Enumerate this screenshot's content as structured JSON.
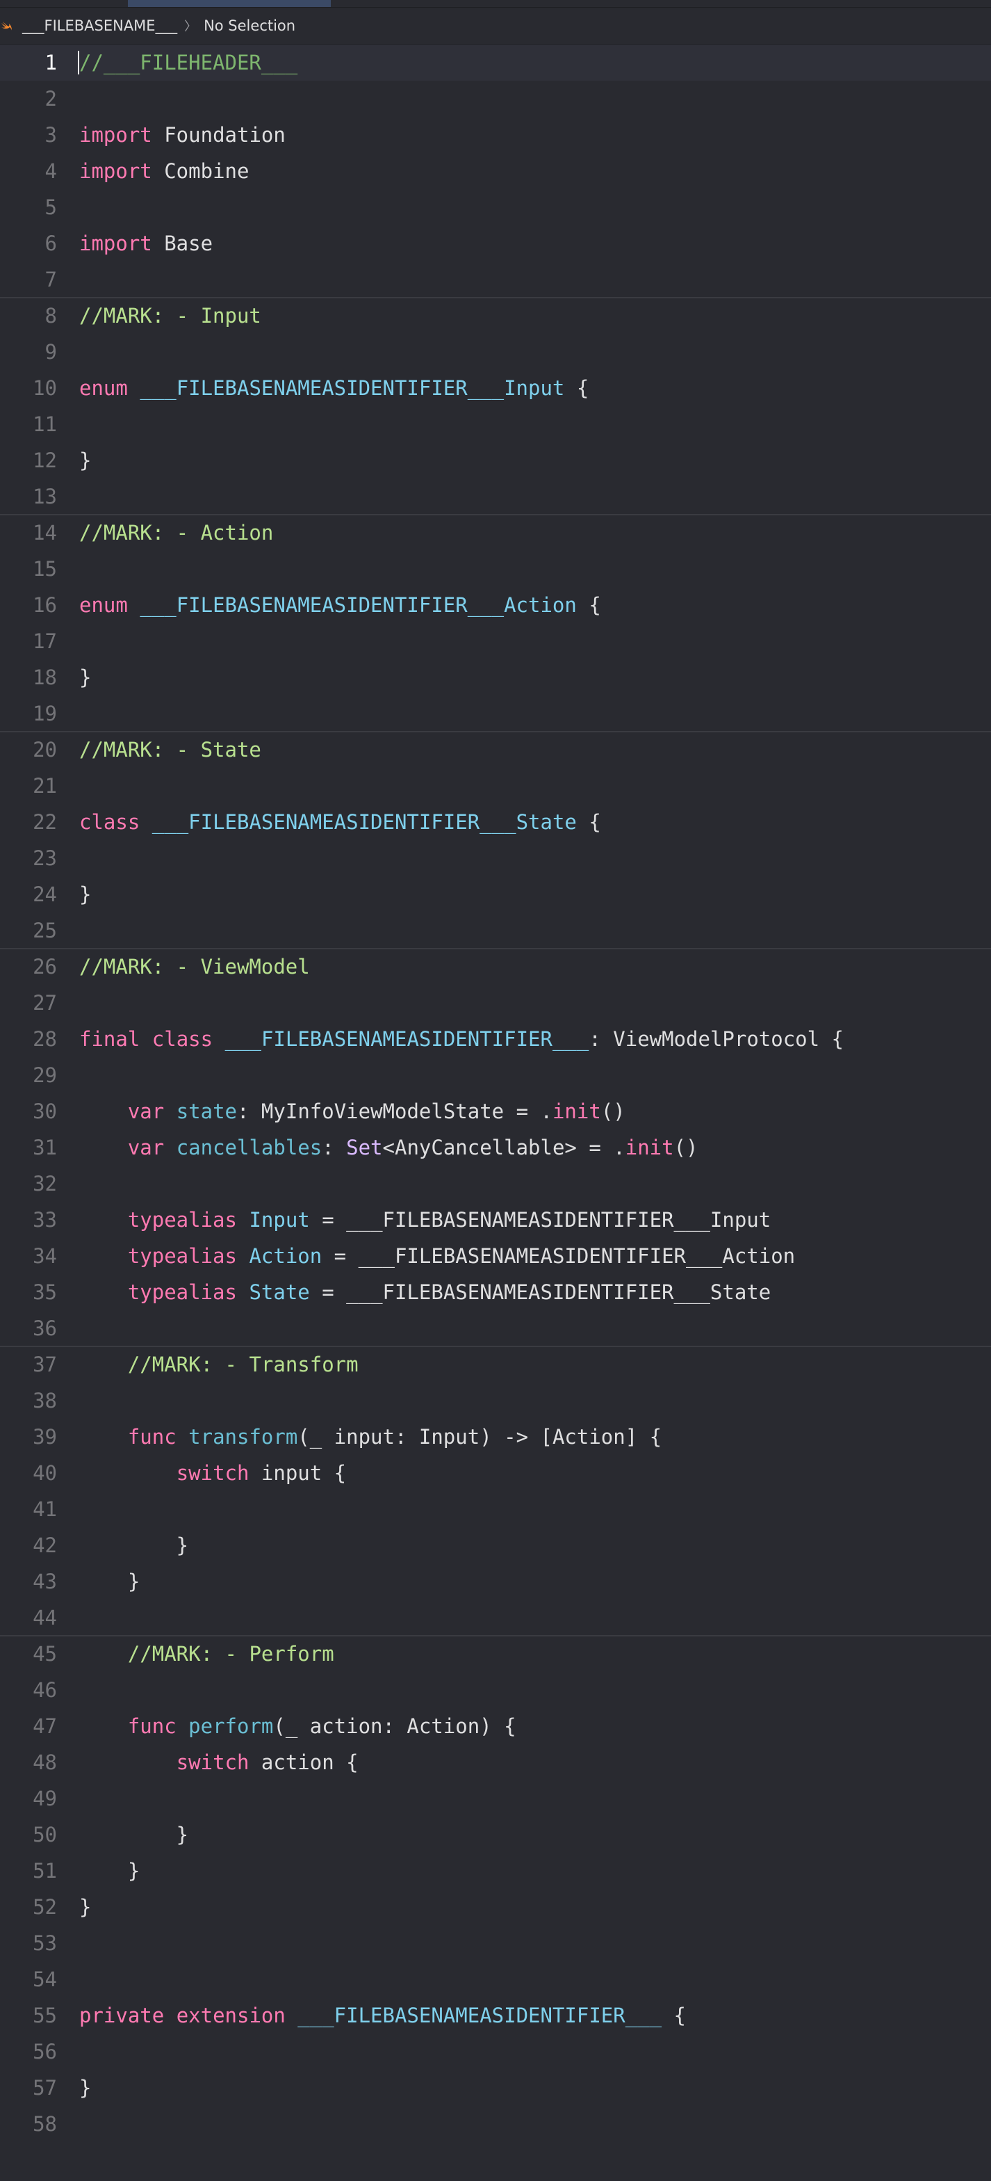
{
  "jumpbar": {
    "file_name": "___FILEBASENAME___",
    "selection": "No Selection"
  },
  "lines": [
    {
      "n": "1",
      "tokens": [
        {
          "t": "//___FILEHEADER___",
          "c": "cm"
        }
      ]
    },
    {
      "n": "2",
      "tokens": []
    },
    {
      "n": "3",
      "tokens": [
        {
          "t": "import",
          "c": "kw"
        },
        {
          "t": " Foundation",
          "c": "pl"
        }
      ]
    },
    {
      "n": "4",
      "tokens": [
        {
          "t": "import",
          "c": "kw"
        },
        {
          "t": " Combine",
          "c": "pl"
        }
      ]
    },
    {
      "n": "5",
      "tokens": []
    },
    {
      "n": "6",
      "tokens": [
        {
          "t": "import",
          "c": "kw"
        },
        {
          "t": " Base",
          "c": "pl"
        }
      ]
    },
    {
      "n": "7",
      "tokens": []
    },
    {
      "n": "8",
      "tokens": [
        {
          "t": "//MARK: - Input",
          "c": "mk"
        }
      ]
    },
    {
      "n": "9",
      "tokens": []
    },
    {
      "n": "10",
      "tokens": [
        {
          "t": "enum",
          "c": "kw"
        },
        {
          "t": " ",
          "c": "pl"
        },
        {
          "t": "___FILEBASENAMEASIDENTIFIER___Input",
          "c": "ty"
        },
        {
          "t": " {",
          "c": "pl"
        }
      ]
    },
    {
      "n": "11",
      "tokens": []
    },
    {
      "n": "12",
      "tokens": [
        {
          "t": "}",
          "c": "pl"
        }
      ]
    },
    {
      "n": "13",
      "tokens": []
    },
    {
      "n": "14",
      "tokens": [
        {
          "t": "//MARK: - Action",
          "c": "mk"
        }
      ]
    },
    {
      "n": "15",
      "tokens": []
    },
    {
      "n": "16",
      "tokens": [
        {
          "t": "enum",
          "c": "kw"
        },
        {
          "t": " ",
          "c": "pl"
        },
        {
          "t": "___FILEBASENAMEASIDENTIFIER___Action",
          "c": "ty"
        },
        {
          "t": " {",
          "c": "pl"
        }
      ]
    },
    {
      "n": "17",
      "tokens": []
    },
    {
      "n": "18",
      "tokens": [
        {
          "t": "}",
          "c": "pl"
        }
      ]
    },
    {
      "n": "19",
      "tokens": []
    },
    {
      "n": "20",
      "tokens": [
        {
          "t": "//MARK: - State",
          "c": "mk"
        }
      ]
    },
    {
      "n": "21",
      "tokens": []
    },
    {
      "n": "22",
      "tokens": [
        {
          "t": "class",
          "c": "kw"
        },
        {
          "t": " ",
          "c": "pl"
        },
        {
          "t": "___FILEBASENAMEASIDENTIFIER___State",
          "c": "ty"
        },
        {
          "t": " {",
          "c": "pl"
        }
      ]
    },
    {
      "n": "23",
      "tokens": []
    },
    {
      "n": "24",
      "tokens": [
        {
          "t": "}",
          "c": "pl"
        }
      ]
    },
    {
      "n": "25",
      "tokens": []
    },
    {
      "n": "26",
      "tokens": [
        {
          "t": "//MARK: - ViewModel",
          "c": "mk"
        }
      ]
    },
    {
      "n": "27",
      "tokens": []
    },
    {
      "n": "28",
      "tokens": [
        {
          "t": "final",
          "c": "kw"
        },
        {
          "t": " ",
          "c": "pl"
        },
        {
          "t": "class",
          "c": "kw"
        },
        {
          "t": " ",
          "c": "pl"
        },
        {
          "t": "___FILEBASENAMEASIDENTIFIER___",
          "c": "ty"
        },
        {
          "t": ": ViewModelProtocol {",
          "c": "pl"
        }
      ]
    },
    {
      "n": "29",
      "tokens": []
    },
    {
      "n": "30",
      "tokens": [
        {
          "t": "    ",
          "c": "pl"
        },
        {
          "t": "var",
          "c": "kw"
        },
        {
          "t": " ",
          "c": "pl"
        },
        {
          "t": "state",
          "c": "prop"
        },
        {
          "t": ": MyInfoViewModelState = .",
          "c": "pl"
        },
        {
          "t": "init",
          "c": "call"
        },
        {
          "t": "()",
          "c": "pl"
        }
      ]
    },
    {
      "n": "31",
      "tokens": [
        {
          "t": "    ",
          "c": "pl"
        },
        {
          "t": "var",
          "c": "kw"
        },
        {
          "t": " ",
          "c": "pl"
        },
        {
          "t": "cancellables",
          "c": "prop"
        },
        {
          "t": ": ",
          "c": "pl"
        },
        {
          "t": "Set",
          "c": "sys"
        },
        {
          "t": "<AnyCancellable> = .",
          "c": "pl"
        },
        {
          "t": "init",
          "c": "call"
        },
        {
          "t": "()",
          "c": "pl"
        }
      ]
    },
    {
      "n": "32",
      "tokens": []
    },
    {
      "n": "33",
      "tokens": [
        {
          "t": "    ",
          "c": "pl"
        },
        {
          "t": "typealias",
          "c": "kw"
        },
        {
          "t": " ",
          "c": "pl"
        },
        {
          "t": "Input",
          "c": "ty"
        },
        {
          "t": " = ___FILEBASENAMEASIDENTIFIER___Input",
          "c": "pl"
        }
      ]
    },
    {
      "n": "34",
      "tokens": [
        {
          "t": "    ",
          "c": "pl"
        },
        {
          "t": "typealias",
          "c": "kw"
        },
        {
          "t": " ",
          "c": "pl"
        },
        {
          "t": "Action",
          "c": "ty"
        },
        {
          "t": " = ___FILEBASENAMEASIDENTIFIER___Action",
          "c": "pl"
        }
      ]
    },
    {
      "n": "35",
      "tokens": [
        {
          "t": "    ",
          "c": "pl"
        },
        {
          "t": "typealias",
          "c": "kw"
        },
        {
          "t": " ",
          "c": "pl"
        },
        {
          "t": "State",
          "c": "ty"
        },
        {
          "t": " = ___FILEBASENAMEASIDENTIFIER___State",
          "c": "pl"
        }
      ]
    },
    {
      "n": "36",
      "tokens": []
    },
    {
      "n": "37",
      "tokens": [
        {
          "t": "    ",
          "c": "pl"
        },
        {
          "t": "//MARK: - Transform",
          "c": "mk"
        }
      ]
    },
    {
      "n": "38",
      "tokens": []
    },
    {
      "n": "39",
      "tokens": [
        {
          "t": "    ",
          "c": "pl"
        },
        {
          "t": "func",
          "c": "kw"
        },
        {
          "t": " ",
          "c": "pl"
        },
        {
          "t": "transform",
          "c": "prop"
        },
        {
          "t": "(_ input: Input) -> [Action] {",
          "c": "pl"
        }
      ]
    },
    {
      "n": "40",
      "tokens": [
        {
          "t": "        ",
          "c": "pl"
        },
        {
          "t": "switch",
          "c": "kw"
        },
        {
          "t": " input {",
          "c": "pl"
        }
      ]
    },
    {
      "n": "41",
      "tokens": []
    },
    {
      "n": "42",
      "tokens": [
        {
          "t": "        }",
          "c": "pl"
        }
      ]
    },
    {
      "n": "43",
      "tokens": [
        {
          "t": "    }",
          "c": "pl"
        }
      ]
    },
    {
      "n": "44",
      "tokens": []
    },
    {
      "n": "45",
      "tokens": [
        {
          "t": "    ",
          "c": "pl"
        },
        {
          "t": "//MARK: - Perform",
          "c": "mk"
        }
      ]
    },
    {
      "n": "46",
      "tokens": []
    },
    {
      "n": "47",
      "tokens": [
        {
          "t": "    ",
          "c": "pl"
        },
        {
          "t": "func",
          "c": "kw"
        },
        {
          "t": " ",
          "c": "pl"
        },
        {
          "t": "perform",
          "c": "prop"
        },
        {
          "t": "(_ action: Action) {",
          "c": "pl"
        }
      ]
    },
    {
      "n": "48",
      "tokens": [
        {
          "t": "        ",
          "c": "pl"
        },
        {
          "t": "switch",
          "c": "kw"
        },
        {
          "t": " action {",
          "c": "pl"
        }
      ]
    },
    {
      "n": "49",
      "tokens": []
    },
    {
      "n": "50",
      "tokens": [
        {
          "t": "        }",
          "c": "pl"
        }
      ]
    },
    {
      "n": "51",
      "tokens": [
        {
          "t": "    }",
          "c": "pl"
        }
      ]
    },
    {
      "n": "52",
      "tokens": [
        {
          "t": "}",
          "c": "pl"
        }
      ]
    },
    {
      "n": "53",
      "tokens": []
    },
    {
      "n": "54",
      "tokens": []
    },
    {
      "n": "55",
      "tokens": [
        {
          "t": "private",
          "c": "kw"
        },
        {
          "t": " ",
          "c": "pl"
        },
        {
          "t": "extension",
          "c": "kw"
        },
        {
          "t": " ",
          "c": "pl"
        },
        {
          "t": "___FILEBASENAMEASIDENTIFIER___",
          "c": "ty"
        },
        {
          "t": " {",
          "c": "pl"
        }
      ]
    },
    {
      "n": "56",
      "tokens": []
    },
    {
      "n": "57",
      "tokens": [
        {
          "t": "}",
          "c": "pl"
        }
      ]
    },
    {
      "n": "58",
      "tokens": []
    }
  ],
  "current_line": "1",
  "mark_lines": [
    "8",
    "14",
    "20",
    "26",
    "37",
    "45"
  ],
  "colors": {
    "background": "#292a30",
    "keyword": "#ff7ab2",
    "type": "#7fd0ec",
    "comment": "#7eb66e",
    "mark": "#b8e08f",
    "plain": "#dfdfe0",
    "line_number": "#747478"
  }
}
